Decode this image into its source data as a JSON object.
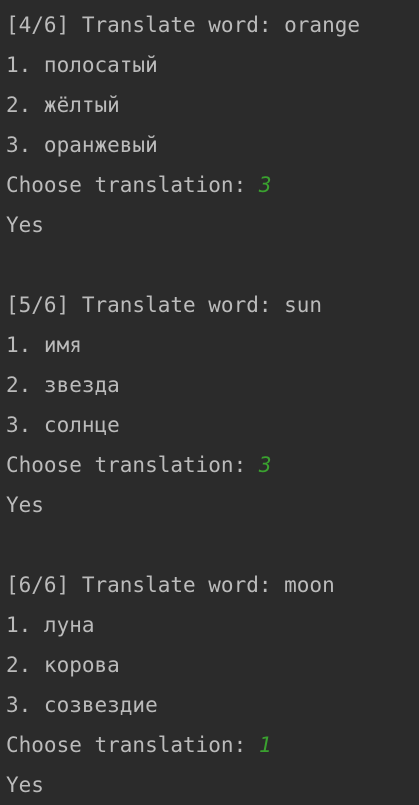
{
  "blocks": [
    {
      "header": "[4/6] Translate word: orange",
      "options": [
        "1. полосатый",
        "2. жёлтый",
        "3. оранжевый"
      ],
      "prompt": "Choose translation: ",
      "answer": "3",
      "result": "Yes"
    },
    {
      "header": "[5/6] Translate word: sun",
      "options": [
        "1. имя",
        "2. звезда",
        "3. солнце"
      ],
      "prompt": "Choose translation: ",
      "answer": "3",
      "result": "Yes"
    },
    {
      "header": "[6/6] Translate word: moon",
      "options": [
        "1. луна",
        "2. корова",
        "3. созвездие"
      ],
      "prompt": "Choose translation: ",
      "answer": "1",
      "result": "Yes"
    }
  ],
  "colors": {
    "background": "#2b2b2b",
    "text": "#bbbbbb",
    "user_input": "#3aa12f"
  }
}
